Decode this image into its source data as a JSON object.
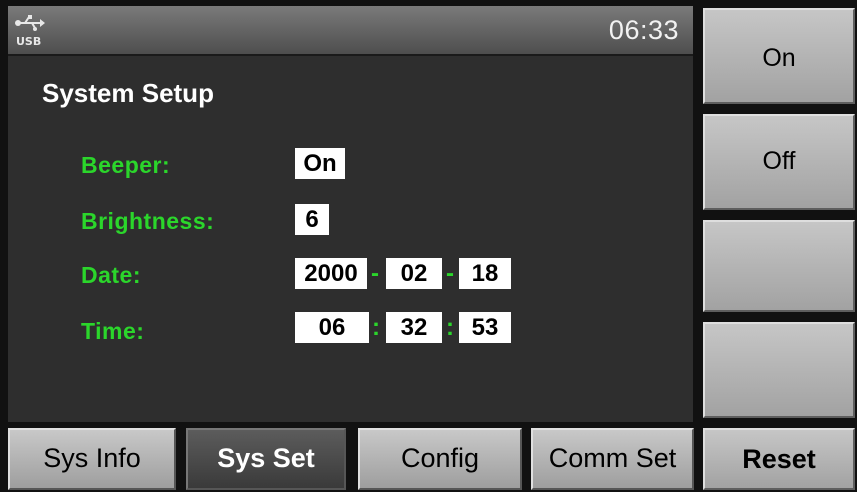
{
  "status_bar": {
    "usb_icon": "usb-icon",
    "usb_text": "USB",
    "clock": "06:33"
  },
  "page": {
    "title": "System Setup"
  },
  "settings": {
    "beeper": {
      "label": "Beeper:",
      "value": "On"
    },
    "brightness": {
      "label": "Brightness:",
      "value": "6"
    },
    "date": {
      "label": "Date:",
      "year": "2000",
      "month": "02",
      "day": "18",
      "separator": "-"
    },
    "time": {
      "label": "Time:",
      "hour": "06",
      "minute": "32",
      "second": "53",
      "separator": ":"
    }
  },
  "side_keys": [
    {
      "label": "On"
    },
    {
      "label": "Off"
    },
    {
      "label": ""
    },
    {
      "label": ""
    },
    {
      "label": "Reset"
    }
  ],
  "tabs": [
    {
      "label": "Sys Info",
      "active": false
    },
    {
      "label": "Sys Set",
      "active": true
    },
    {
      "label": "Config",
      "active": false
    },
    {
      "label": "Comm Set",
      "active": false
    }
  ],
  "colors": {
    "label_green": "#2bd62b",
    "panel_bg": "#2e2e2e",
    "key_gray": "#b4b4b4",
    "active_tab": "#4a4a4a"
  }
}
